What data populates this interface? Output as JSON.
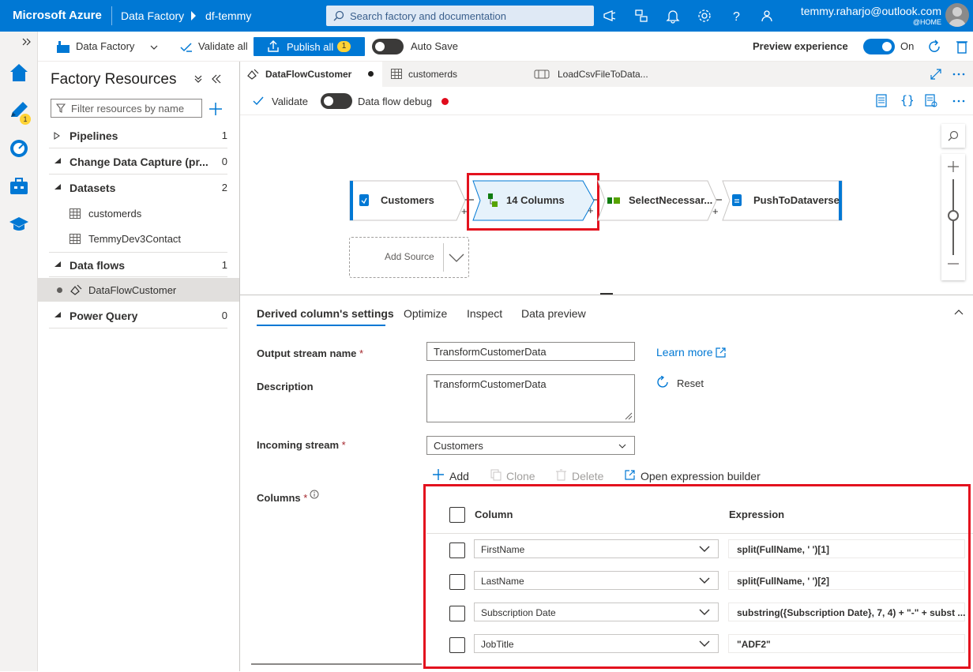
{
  "topbar": {
    "brand": "Microsoft Azure",
    "crumb1": "Data Factory",
    "crumb2": "df-temmy",
    "search_placeholder": "Search factory and documentation",
    "account_email": "temmy.raharjo@outlook.com",
    "account_dir": "@HOME"
  },
  "rail": {
    "author_badge": "1"
  },
  "cmdbar": {
    "datafactory_label": "Data Factory",
    "validate_all": "Validate all",
    "publish_all": "Publish all",
    "publish_badge": "1",
    "auto_save": "Auto Save",
    "preview_experience": "Preview experience",
    "preview_state": "On"
  },
  "resources": {
    "title": "Factory Resources",
    "filter_placeholder": "Filter resources by name",
    "groups": [
      {
        "label": "Pipelines",
        "count": "1"
      },
      {
        "label": "Change Data Capture (pr...",
        "count": "0"
      },
      {
        "label": "Datasets",
        "count": "2"
      },
      {
        "label": "Data flows",
        "count": "1"
      },
      {
        "label": "Power Query",
        "count": "0"
      }
    ],
    "datasets": [
      "customerds",
      "TemmyDev3Contact"
    ],
    "dataflows": [
      "DataFlowCustomer"
    ]
  },
  "tabs": [
    {
      "label": "DataFlowCustomer"
    },
    {
      "label": "customerds"
    },
    {
      "label": "LoadCsvFileToData..."
    }
  ],
  "dftoolbar": {
    "validate": "Validate",
    "debug": "Data flow debug"
  },
  "canvas": {
    "nodes": [
      {
        "label": "Customers"
      },
      {
        "label": "14 Columns"
      },
      {
        "label": "SelectNecessar..."
      },
      {
        "label": "PushToDataverse"
      }
    ],
    "add_source": "Add Source"
  },
  "settings": {
    "tabs": [
      "Derived column's settings",
      "Optimize",
      "Inspect",
      "Data preview"
    ],
    "output_stream_label": "Output stream name",
    "output_stream_value": "TransformCustomerData",
    "learn_more": "Learn more",
    "description_label": "Description",
    "description_value": "TransformCustomerData",
    "reset": "Reset",
    "incoming_label": "Incoming stream",
    "incoming_value": "Customers",
    "actions": {
      "add": "Add",
      "clone": "Clone",
      "delete": "Delete",
      "open_builder": "Open expression builder"
    },
    "columns_label": "Columns",
    "table": {
      "col_header": "Column",
      "expr_header": "Expression",
      "rows": [
        {
          "column": "FirstName",
          "expression": "split(FullName, ' ')[1]"
        },
        {
          "column": "LastName",
          "expression": "split(FullName, ' ')[2]"
        },
        {
          "column": "Subscription Date",
          "expression": "substring({Subscription Date}, 7, 4) + \"-\" + subst ..."
        },
        {
          "column": "JobTitle",
          "expression": "\"ADF2\""
        }
      ]
    }
  },
  "colors": {
    "azure_blue": "#0078d4",
    "highlight_red": "#e3121e",
    "debug_dot": "#e00b1c"
  }
}
